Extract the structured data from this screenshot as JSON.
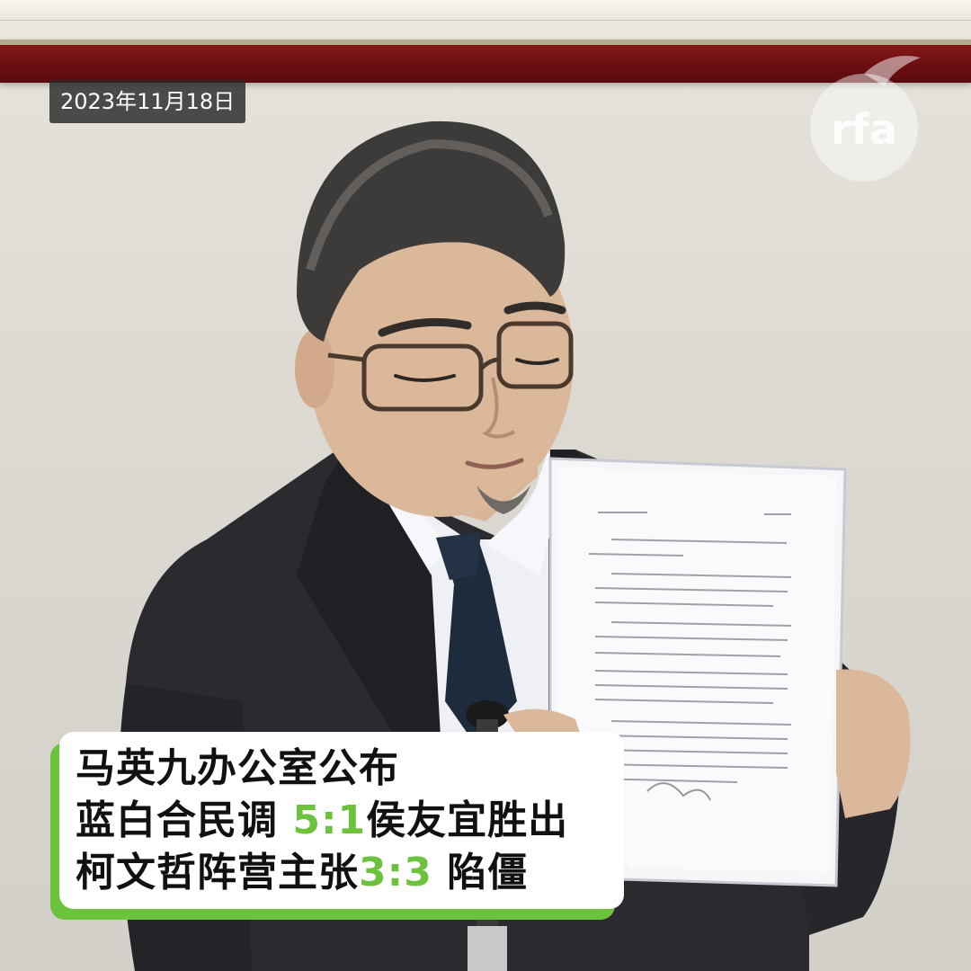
{
  "date_badge": "2023年11月18日",
  "logo": {
    "text": "rfa",
    "icon": "rfa-logo-icon",
    "color": "#ffffff"
  },
  "caption": {
    "line1": "马英九办公室公布",
    "line2_prefix": "蓝白合民调 ",
    "line2_highlight": "5:1",
    "line2_suffix": "侯友宜胜出",
    "line3_prefix": "柯文哲阵营主张",
    "line3_highlight": "3:3",
    "line3_suffix": " 陷僵",
    "highlight_color": "#6cc13d",
    "text_color": "#111111"
  },
  "colors": {
    "molding": "#6e0f12",
    "wall": "#dedbd4",
    "suit": "#2a2a2f",
    "shirt": "#eef0f4",
    "tie": "#1e2b3d"
  }
}
